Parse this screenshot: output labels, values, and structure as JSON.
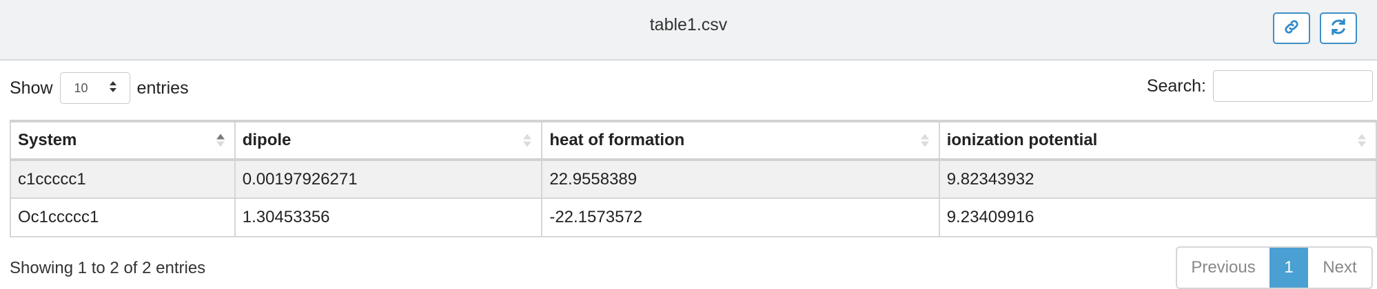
{
  "header": {
    "title": "table1.csv",
    "icons": [
      "link-icon",
      "refresh-icon"
    ],
    "accent_color": "#2f8ac9"
  },
  "controls": {
    "show_label": "Show",
    "entries_value": "10",
    "entries_label": "entries",
    "search_label": "Search:",
    "search_value": ""
  },
  "table": {
    "headers": [
      "System",
      "dipole",
      "heat of formation",
      "ionization potential"
    ],
    "rows": [
      [
        "c1ccccc1",
        "0.00197926271",
        "22.9558389",
        "9.82343932"
      ],
      [
        "Oc1ccccc1",
        "1.30453356",
        "-22.1573572",
        "9.23409916"
      ]
    ],
    "sorted_column": "System",
    "sort_direction": "ascending"
  },
  "footer": {
    "info": "Showing 1 to 2 of 2 entries",
    "previous_label": "Previous",
    "current_page": "1",
    "next_label": "Next",
    "active_color": "#4aa0d2"
  }
}
